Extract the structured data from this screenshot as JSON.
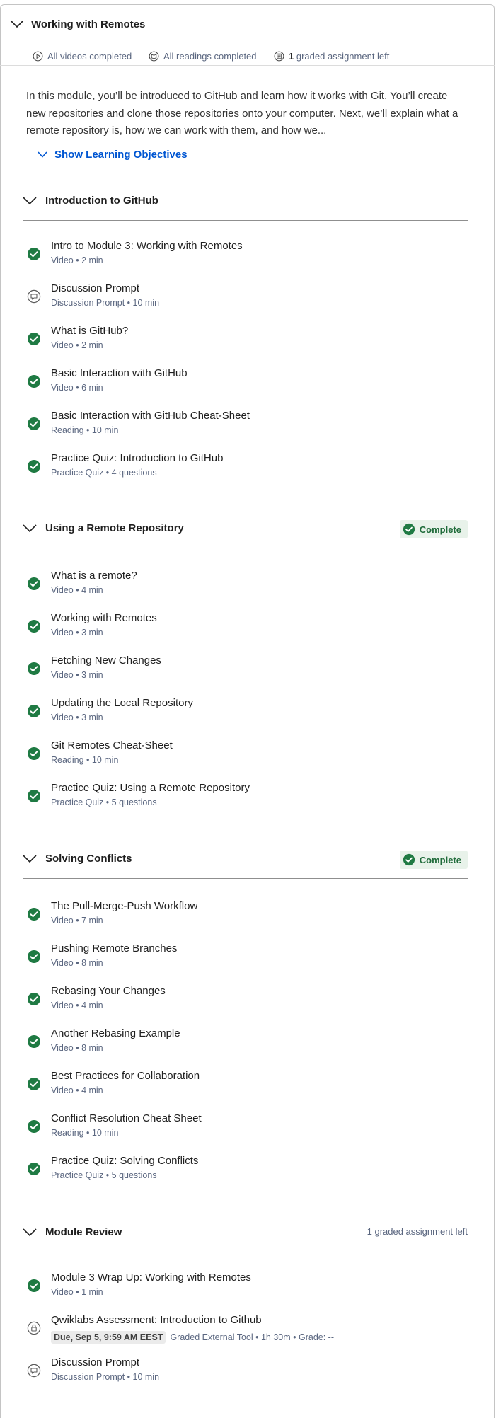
{
  "module": {
    "title": "Working with Remotes",
    "stats": {
      "videos": "All videos completed",
      "readings": "All readings completed",
      "graded_count": "1",
      "graded_text": "graded assignment left"
    },
    "description": "In this module, you’ll be introduced to GitHub and learn how it works with Git. You’ll create new repositories and clone those repositories onto your computer. Next, we’ll explain what a remote repository is, how we can work with them, and how we...",
    "show_objectives": "Show Learning Objectives"
  },
  "colors": {
    "accent": "#0056d2",
    "success": "#1f7a43",
    "badge_bg": "#e8f2ea"
  },
  "sections": [
    {
      "title": "Introduction to GitHub",
      "badge": "",
      "items": [
        {
          "title": "Intro to Module 3: Working with Remotes",
          "meta": "Video • 2 min",
          "icon": "check-icon"
        },
        {
          "title": "Discussion Prompt",
          "meta": "Discussion Prompt • 10 min",
          "icon": "discussion-icon"
        },
        {
          "title": "What is GitHub?",
          "meta": "Video • 2 min",
          "icon": "check-icon"
        },
        {
          "title": "Basic Interaction with GitHub",
          "meta": "Video • 6 min",
          "icon": "check-icon"
        },
        {
          "title": "Basic Interaction with GitHub Cheat-Sheet",
          "meta": "Reading • 10 min",
          "icon": "check-icon"
        },
        {
          "title": "Practice Quiz: Introduction to GitHub",
          "meta": "Practice Quiz • 4 questions",
          "icon": "check-icon"
        }
      ]
    },
    {
      "title": "Using a Remote Repository",
      "badge": "Complete",
      "items": [
        {
          "title": "What is a remote?",
          "meta": "Video • 4 min",
          "icon": "check-icon"
        },
        {
          "title": "Working with Remotes",
          "meta": "Video • 3 min",
          "icon": "check-icon"
        },
        {
          "title": "Fetching New Changes",
          "meta": "Video • 3 min",
          "icon": "check-icon"
        },
        {
          "title": "Updating the Local Repository",
          "meta": "Video • 3 min",
          "icon": "check-icon"
        },
        {
          "title": "Git Remotes Cheat-Sheet",
          "meta": "Reading • 10 min",
          "icon": "check-icon"
        },
        {
          "title": "Practice Quiz: Using a Remote Repository",
          "meta": "Practice Quiz • 5 questions",
          "icon": "check-icon"
        }
      ]
    },
    {
      "title": "Solving Conflicts",
      "badge": "Complete",
      "items": [
        {
          "title": "The Pull-Merge-Push Workflow",
          "meta": "Video • 7 min",
          "icon": "check-icon"
        },
        {
          "title": "Pushing Remote Branches",
          "meta": "Video • 8 min",
          "icon": "check-icon"
        },
        {
          "title": "Rebasing Your Changes",
          "meta": "Video • 4 min",
          "icon": "check-icon"
        },
        {
          "title": "Another Rebasing Example",
          "meta": "Video • 8 min",
          "icon": "check-icon"
        },
        {
          "title": "Best Practices for Collaboration",
          "meta": "Video • 4 min",
          "icon": "check-icon"
        },
        {
          "title": "Conflict Resolution Cheat Sheet",
          "meta": "Reading • 10 min",
          "icon": "check-icon"
        },
        {
          "title": "Practice Quiz: Solving Conflicts",
          "meta": "Practice Quiz • 5 questions",
          "icon": "check-icon"
        }
      ]
    },
    {
      "title": "Module Review",
      "badge": "",
      "graded_left": "1 graded assignment left",
      "items": [
        {
          "title": "Module 3 Wrap Up: Working with Remotes",
          "meta": "Video • 1 min",
          "icon": "check-icon"
        },
        {
          "title": "Qwiklabs Assessment: Introduction to Github",
          "due": "Due, Sep 5, 9:59 AM EEST",
          "meta": "Graded External Tool • 1h 30m • Grade: --",
          "icon": "lock-icon"
        },
        {
          "title": "Discussion Prompt",
          "meta": "Discussion Prompt • 10 min",
          "icon": "discussion-icon"
        }
      ]
    }
  ]
}
